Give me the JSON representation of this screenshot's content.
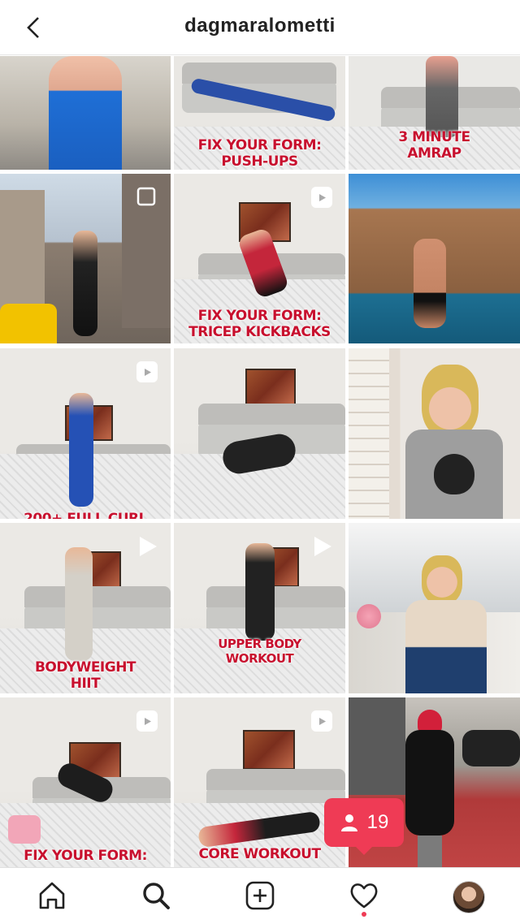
{
  "header": {
    "title": "dagmaralometti"
  },
  "posts": [
    {
      "caption": ""
    },
    {
      "caption": "FIX YOUR FORM:\nPUSH-UPS"
    },
    {
      "caption": "3 MINUTE\nAMRAP"
    },
    {
      "caption": ""
    },
    {
      "caption": "FIX YOUR FORM:\nTRICEP KICKBACKS"
    },
    {
      "caption": ""
    },
    {
      "caption": "200+ FULL CURL"
    },
    {
      "caption": ""
    },
    {
      "caption": ""
    },
    {
      "caption": "BODYWEIGHT\nHIIT"
    },
    {
      "caption": "UPPER BODY\nWORKOUT"
    },
    {
      "caption": ""
    },
    {
      "caption": "FIX YOUR FORM:"
    },
    {
      "caption": "CORE WORKOUT"
    },
    {
      "caption": ""
    }
  ],
  "notification": {
    "count": "19"
  },
  "colors": {
    "accent": "#ef3b55",
    "caption": "#c8102e"
  },
  "nav": [
    "home-icon",
    "search-icon",
    "add-post-icon",
    "heart-icon",
    "profile-avatar"
  ]
}
